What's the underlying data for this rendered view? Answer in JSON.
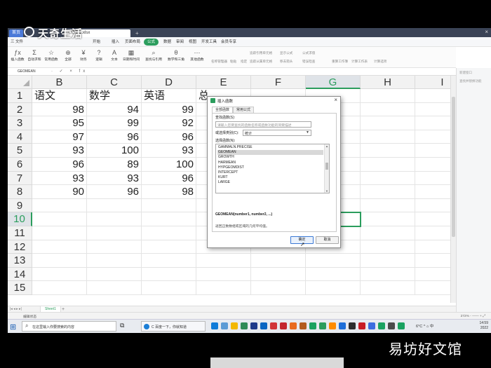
{
  "app": {
    "home_tab": "首页",
    "doc_tab": "工作簿1.xlsx",
    "add_tab": "+",
    "close": "×"
  },
  "menus": [
    "三 文件",
    "开始",
    "插入",
    "页面布局",
    "公式",
    "数据",
    "审阅",
    "视图",
    "开发工具",
    "会员专享"
  ],
  "ribbon": {
    "buttons": [
      "插入函数",
      "自动求和",
      "常用函数",
      "全部",
      "财务",
      "逻辑",
      "文本",
      "日期和时间",
      "查找与引用",
      "数学和三角",
      "其他函数"
    ],
    "small": [
      "名称管理器",
      "粘贴",
      "指定",
      "追踪引用单元格",
      "追踪从属单元格",
      "移去箭头",
      "显示公式",
      "错误检查",
      "公式求值",
      "重算工作簿",
      "计算工作表",
      "计算选项"
    ]
  },
  "formula_bar": {
    "name_box": "GEOMEAN",
    "icons": "· ✓ × fx"
  },
  "grid": {
    "columns": [
      "B",
      "C",
      "D",
      "E",
      "F",
      "G",
      "H",
      "I"
    ],
    "selected_column": "G",
    "rows": [
      "1",
      "2",
      "3",
      "4",
      "5",
      "6",
      "7",
      "8",
      "9",
      "10",
      "11",
      "12",
      "13",
      "14",
      "15"
    ],
    "selected_row": "10",
    "headers": [
      "语文",
      "数学",
      "英语",
      "总"
    ],
    "values": [
      [
        "98",
        "94",
        "99"
      ],
      [
        "95",
        "99",
        "92"
      ],
      [
        "97",
        "96",
        "96"
      ],
      [
        "93",
        "100",
        "93"
      ],
      [
        "96",
        "89",
        "100"
      ],
      [
        "93",
        "93",
        "96"
      ],
      [
        "90",
        "96",
        "98"
      ]
    ]
  },
  "sheet": {
    "name": "Sheet1",
    "add": "+",
    "nav": "|◂ ◂ ▸ ▸|"
  },
  "status": {
    "left": "编辑状态",
    "right": "272% -  ——  + ⤢"
  },
  "right_panel": {
    "title": "新建窗口",
    "hint": "查找并替换功能"
  },
  "taskbar": {
    "search_text": "在这里输入你要搜索的内容",
    "edge_task": "C 百度一下，你就知道",
    "tray": "6°C  ^  ⌂  中",
    "clock_time": "14:59",
    "clock_date": "2022"
  },
  "dialog": {
    "title": "插入函数",
    "tab_all": "全部函数",
    "tab_common": "常用公式",
    "search_label": "查找函数(S):",
    "search_placeholder": "请输入您要查找的函数名称或函数功能的简要描述",
    "category_label": "或选择类别(C):",
    "category_value": "统计",
    "list_label": "选择函数(N):",
    "functions": [
      "GAMMALN.PRECISE",
      "GEOMEAN",
      "GROWTH",
      "HARMEAN",
      "HYPGEOMDIST",
      "INTERCEPT",
      "KURT",
      "LARGE"
    ],
    "selected_function": "GEOMEAN",
    "syntax": "GEOMEAN(number1, number2, ...)",
    "description": "返回正数数组或区域的几何平均值。",
    "ok": "确定",
    "cancel": "取消"
  },
  "watermarks": {
    "top": "天奇生活",
    "bottom": "易坊好文馆"
  }
}
